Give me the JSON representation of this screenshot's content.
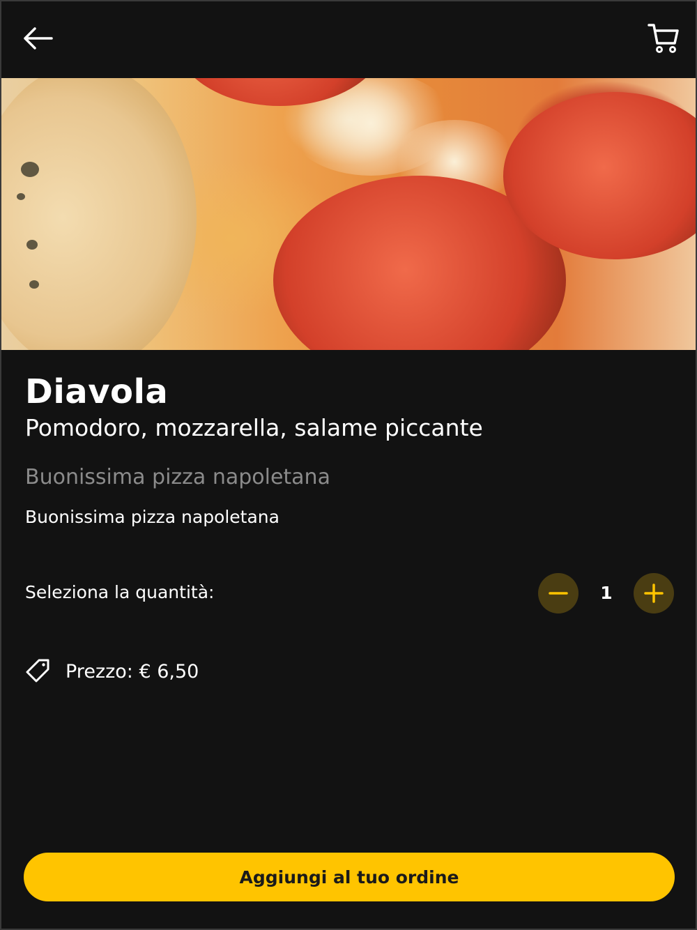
{
  "header": {
    "back_icon": "arrow-left-icon",
    "cart_icon": "shopping-cart-icon"
  },
  "hero": {
    "image": "pizza-diavola-photo"
  },
  "product": {
    "name": "Diavola",
    "ingredients": "Pomodoro, mozzarella, salame piccante",
    "tagline": "Buonissima pizza napoletana",
    "description": "Buonissima pizza napoletana"
  },
  "quantity": {
    "label": "Seleziona la quantità:",
    "value": "1",
    "minus_icon": "minus-icon",
    "plus_icon": "plus-icon"
  },
  "price": {
    "icon": "price-tag-icon",
    "text": "Prezzo: € 6,50"
  },
  "cta": {
    "label": "Aggiungi al tuo ordine"
  },
  "colors": {
    "background": "#121212",
    "accent": "#ffc400",
    "stepper_bg": "#4a3d12",
    "muted_text": "#8b8b8b"
  }
}
